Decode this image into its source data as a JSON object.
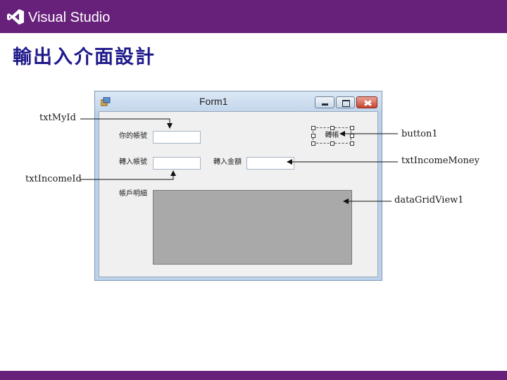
{
  "header": {
    "brand": "Visual Studio",
    "logo_icon": "visual-studio-logo-icon",
    "colors": {
      "brand_purple": "#68217a",
      "heading_blue": "#1f1a8a"
    }
  },
  "page": {
    "heading": "輸出入介面設計"
  },
  "form": {
    "title": "Form1",
    "window_buttons": [
      "minimize-icon",
      "maximize-icon",
      "close-icon"
    ],
    "labels": {
      "my_id": "你的帳號",
      "income_id": "轉入帳號",
      "income_money": "轉入金額",
      "details": "帳戶明細"
    },
    "button_text": "轉帳",
    "textbox_values": {
      "my_id": "",
      "income_id": "",
      "income_money": ""
    }
  },
  "callouts": {
    "txt_my_id": "txtMyId",
    "txt_income_id": "txtIncomeId",
    "button1": "button1",
    "txt_income_money": "txtIncomeMoney",
    "data_grid_view1": "dataGridView1"
  }
}
